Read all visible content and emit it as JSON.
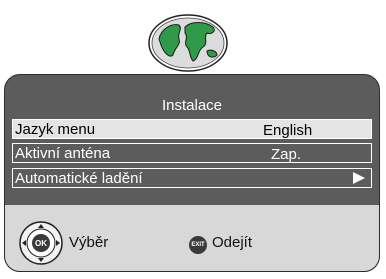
{
  "menu": {
    "title": "Instalace",
    "items": [
      {
        "label": "Jazyk menu",
        "value": "English"
      },
      {
        "label": "Aktivní anténa",
        "value": "Zap."
      },
      {
        "label": "Automatické ladění",
        "value": ""
      }
    ]
  },
  "footer": {
    "ok_icon_text": "OK",
    "ok_label": "Výběr",
    "exit_icon_text": "EXIT",
    "exit_label": "Odejít"
  },
  "icons": {
    "logo": "globe-icon",
    "row_arrow": "play-arrow-icon",
    "ok_button": "ok-navigation-icon",
    "exit_button": "exit-icon"
  },
  "colors": {
    "panel": "#5c5c5c",
    "footer": "#d8d8d8",
    "selected_row": "#e4e4e4",
    "globe_land": "#2e9a4a"
  }
}
